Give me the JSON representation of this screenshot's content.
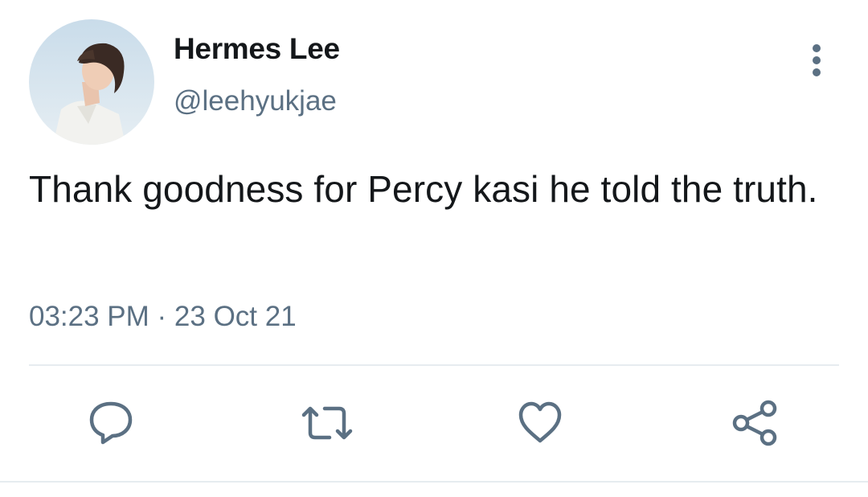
{
  "user": {
    "display_name": "Hermes Lee",
    "handle": "@leehyukjae"
  },
  "tweet": {
    "text": "Thank goodness for Percy kasi he told the truth.",
    "time": "03:23 PM",
    "separator": " · ",
    "date": "23 Oct 21"
  },
  "actions": [
    "reply",
    "retweet",
    "like",
    "share"
  ],
  "colors": {
    "text_primary": "#14171a",
    "text_secondary": "#5b7083",
    "divider": "#e6ecf0",
    "icon": "#5b7083"
  }
}
